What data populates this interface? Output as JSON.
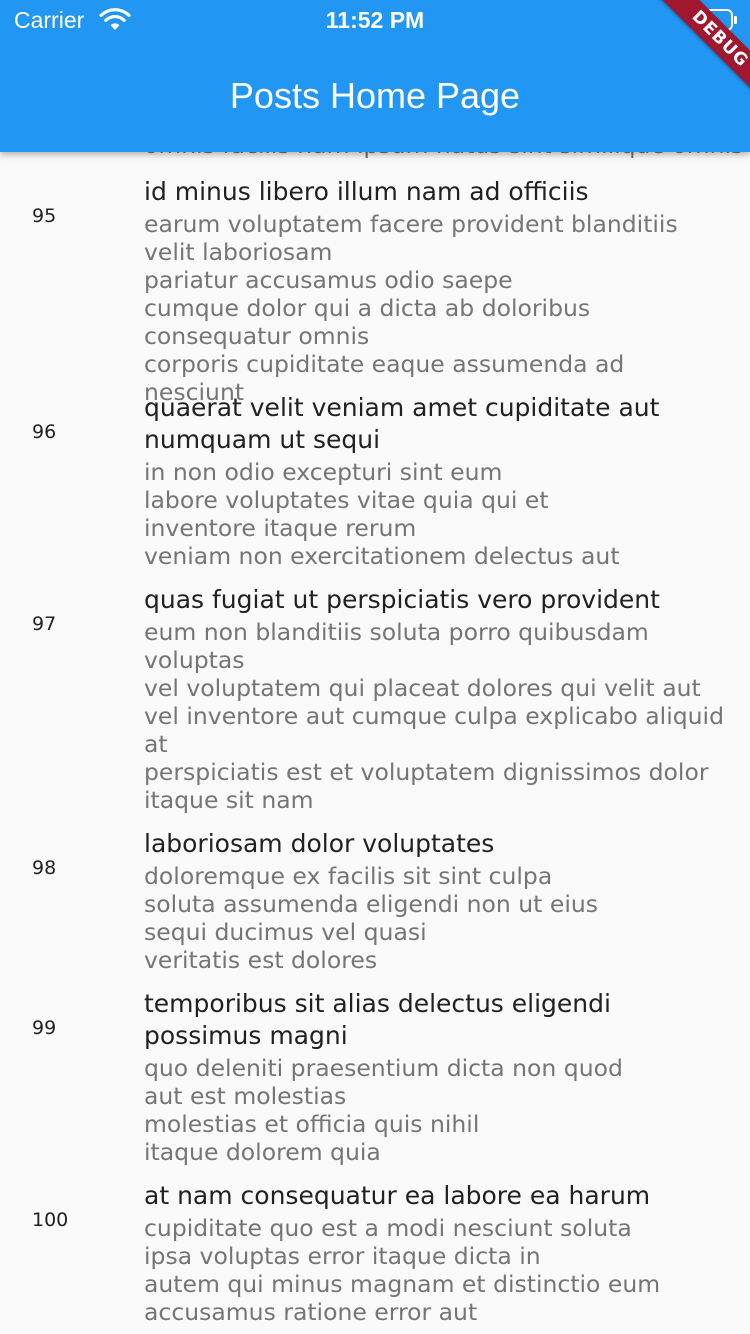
{
  "status_bar": {
    "carrier": "Carrier",
    "time": "11:52 PM",
    "wifi_icon": "wifi-icon",
    "battery_icon": "battery-icon"
  },
  "app_bar": {
    "title": "Posts Home Page",
    "color": "#2196f3"
  },
  "debug_banner": {
    "label": "DEBUG",
    "color": "#a0172f"
  },
  "list": {
    "peek_line": "omnis facilis nam ipsum natus sint similique omnis",
    "items": [
      {
        "id": "95",
        "title": "id minus libero illum nam ad officiis",
        "body": "earum voluptatem facere provident blanditiis velit laboriosam\npariatur accusamus odio saepe\ncumque dolor qui a dicta ab doloribus consequatur omnis\ncorporis cupiditate eaque assumenda ad nesciunt"
      },
      {
        "id": "96",
        "title": "quaerat velit veniam amet cupiditate aut numquam ut sequi",
        "body": "in non odio excepturi sint eum\nlabore voluptates vitae quia qui et\ninventore itaque rerum\nveniam non exercitationem delectus aut"
      },
      {
        "id": "97",
        "title": "quas fugiat ut perspiciatis vero provident",
        "body": "eum non blanditiis soluta porro quibusdam voluptas\nvel voluptatem qui placeat dolores qui velit aut\nvel inventore aut cumque culpa explicabo aliquid at\nperspiciatis est et voluptatem dignissimos dolor itaque sit nam"
      },
      {
        "id": "98",
        "title": "laboriosam dolor voluptates",
        "body": "doloremque ex facilis sit sint culpa\nsoluta assumenda eligendi non ut eius\nsequi ducimus vel quasi\nveritatis est dolores"
      },
      {
        "id": "99",
        "title": "temporibus sit alias delectus eligendi possimus magni",
        "body": "quo deleniti praesentium dicta non quod\naut est molestias\nmolestias et officia quis nihil\nitaque dolorem quia"
      },
      {
        "id": "100",
        "title": "at nam consequatur ea labore ea harum",
        "body": "cupiditate quo est a modi nesciunt soluta\nipsa voluptas error itaque dicta in\nautem qui minus magnam et distinctio eum\naccusamus ratione error aut"
      }
    ]
  }
}
